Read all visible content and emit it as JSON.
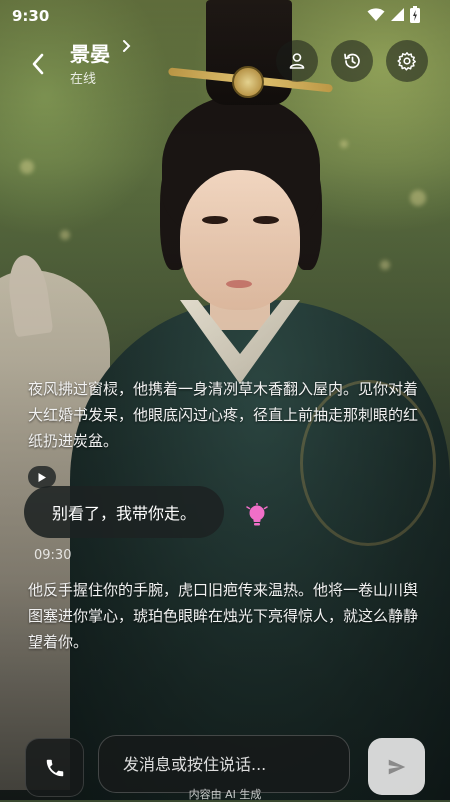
{
  "status_bar": {
    "time": "9:30"
  },
  "header": {
    "title": "景晏",
    "subtitle": "在线"
  },
  "chat": {
    "narration_1": "夜风拂过窗棂，他携着一身清冽草木香翻入屋内。见你对着大红婚书发呆，他眼底闪过心疼，径直上前抽走那刺眼的红纸扔进炭盆。",
    "dialogue": "别看了，我带你走。",
    "timestamp": "09:30",
    "narration_2": "他反手握住你的手腕，虎口旧疤传来温热。他将一卷山川舆图塞进你掌心，琥珀色眼眸在烛光下亮得惊人，就这么静静望着你。"
  },
  "input_bar": {
    "placeholder": "发消息或按住说话...",
    "disclaimer": "内容由 AI 生成"
  },
  "colors": {
    "bulb": "#f06fc8",
    "bubble": "#1c2222",
    "send_button": "#e6e6e6"
  },
  "icons": [
    "back-icon",
    "chevron-right-icon",
    "person-icon",
    "history-icon",
    "gear-icon",
    "play-icon",
    "lightbulb-icon",
    "phone-icon",
    "send-icon",
    "wifi-icon",
    "signal-icon",
    "battery-icon"
  ]
}
